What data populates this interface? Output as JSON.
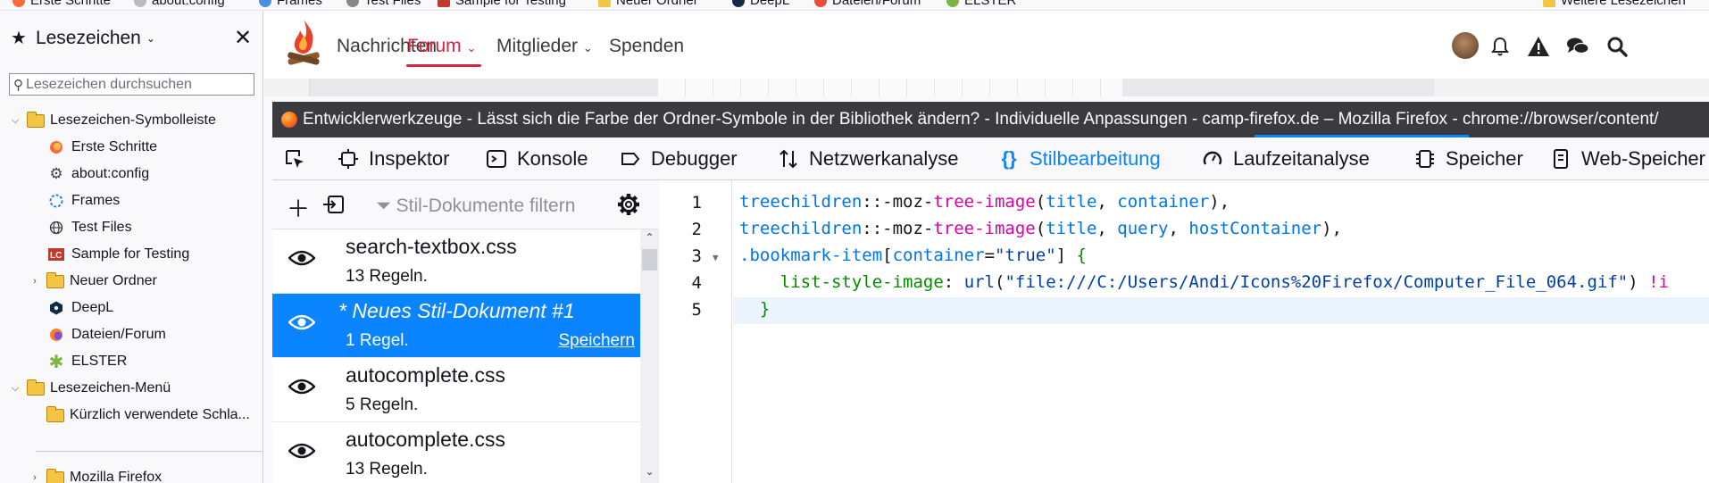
{
  "bookmarks_toolbar": {
    "items": [
      "Erste Schritte",
      "about:config",
      "Frames",
      "Test Files",
      "Sample for Testing",
      "Neuer Ordner",
      "DeepL",
      "Dateien/Forum",
      "ELSTER"
    ],
    "more": "Weitere Lesezeichen"
  },
  "sidebar": {
    "title": "Lesezeichen",
    "search_placeholder": "Lesezeichen durchsuchen",
    "tree": [
      {
        "label": "Lesezeichen-Symbolleiste",
        "type": "folder",
        "expanded": true,
        "level": 0
      },
      {
        "label": "Erste Schritte",
        "type": "bookmark",
        "icon": "firefox-icon",
        "level": 1
      },
      {
        "label": "about:config",
        "type": "bookmark",
        "icon": "gear-icon",
        "level": 1
      },
      {
        "label": "Frames",
        "type": "bookmark",
        "icon": "dotted-globe-icon",
        "level": 1
      },
      {
        "label": "Test Files",
        "type": "bookmark",
        "icon": "globe-icon",
        "level": 1
      },
      {
        "label": "Sample for Testing",
        "type": "bookmark",
        "icon": "lc-logo-icon",
        "level": 1
      },
      {
        "label": "Neuer Ordner",
        "type": "folder",
        "expanded": false,
        "level": 1
      },
      {
        "label": "DeepL",
        "type": "bookmark",
        "icon": "deepl-icon",
        "level": 1
      },
      {
        "label": "Dateien/Forum",
        "type": "bookmark",
        "icon": "camp-firefox-icon",
        "level": 1
      },
      {
        "label": "ELSTER",
        "type": "bookmark",
        "icon": "elster-star-icon",
        "level": 1
      },
      {
        "label": "Lesezeichen-Menü",
        "type": "folder",
        "expanded": true,
        "level": 0
      },
      {
        "label": "Kürzlich verwendete Schla...",
        "type": "folder",
        "level": 1
      },
      {
        "label": "Mozilla Firefox",
        "type": "folder",
        "expanded": false,
        "level": 1
      }
    ]
  },
  "site": {
    "nav": [
      "Nachrichten",
      "Forum",
      "Mitglieder",
      "Spenden"
    ],
    "active": "Forum"
  },
  "devtools": {
    "window_title": "Entwicklerwerkzeuge - Lässt sich die Farbe der Ordner-Symbole in der Bibliothek ändern? - Individuelle Anpassungen - camp-firefox.de – Mozilla Firefox - chrome://browser/content/",
    "tabs": [
      "Inspektor",
      "Konsole",
      "Debugger",
      "Netzwerkanalyse",
      "Stilbearbeitung",
      "Laufzeitanalyse",
      "Speicher",
      "Web-Speicher"
    ],
    "selected_tab": "Stilbearbeitung",
    "filter_placeholder": "Stil-Dokumente filtern",
    "sheets": [
      {
        "name": "search-textbox.css",
        "rules": "13 Regeln.",
        "selected": false
      },
      {
        "name": "* Neues Stil-Dokument #1",
        "rules": "1 Regel.",
        "selected": true,
        "save_label": "Speichern"
      },
      {
        "name": "autocomplete.css",
        "rules": "5 Regeln.",
        "selected": false
      },
      {
        "name": "autocomplete.css",
        "rules": "13 Regeln.",
        "selected": false
      }
    ],
    "editor": {
      "line_numbers": [
        "1",
        "2",
        "3",
        "4",
        "5"
      ],
      "lines": [
        "treechildren::-moz-tree-image(title, container),",
        "treechildren::-moz-tree-image(title, query, hostContainer),",
        ".bookmark-item[container=\"true\"] {",
        "    list-style-image: url(\"file:///C:/Users/Andi/Icons%20Firefox/Computer_File_064.gif\") !i",
        "  }"
      ]
    }
  },
  "colors": {
    "accent": "#0a84ff",
    "forum_red": "#d6233f",
    "titlebar": "#3b3b3f"
  }
}
